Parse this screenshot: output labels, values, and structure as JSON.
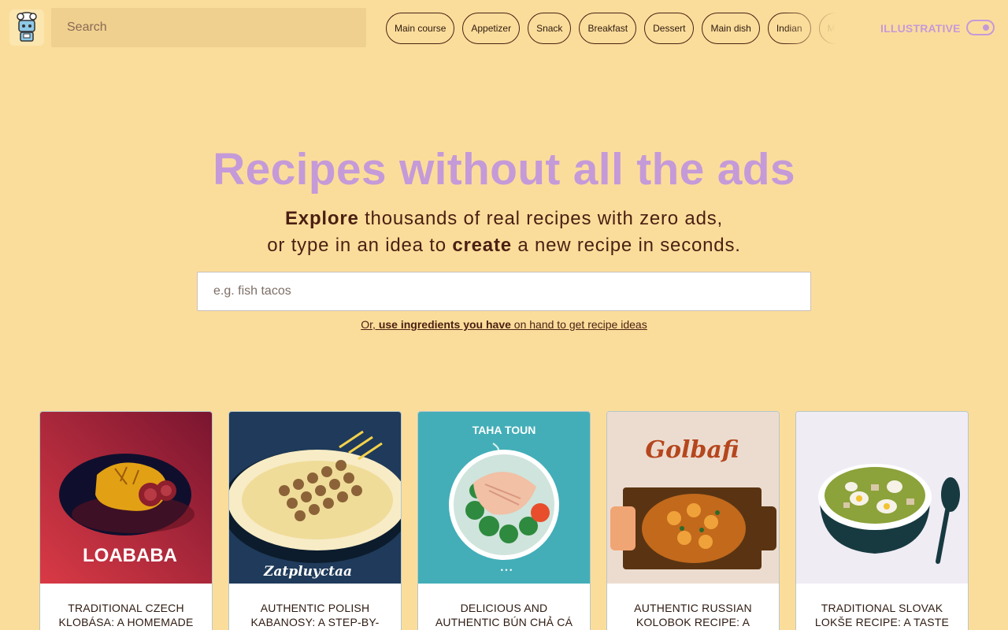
{
  "header": {
    "search_placeholder": "Search",
    "categories": [
      "Main course",
      "Appetizer",
      "Snack",
      "Breakfast",
      "Dessert",
      "Main dish",
      "Indian",
      "Mexican"
    ],
    "mode_label": "ILLUSTRATIVE",
    "mode_toggle_on": true,
    "logo_icon": "chef-robot-icon"
  },
  "hero": {
    "title": "Recipes without all the ads",
    "sub_line1_bold": "Explore",
    "sub_line1_rest": " thousands of real recipes with zero ads,",
    "sub_line2_start": "or type in an idea to ",
    "sub_line2_bold": "create",
    "sub_line2_end": " a new recipe in seconds.",
    "idea_placeholder": "e.g. fish tacos",
    "ingredients_prefix": "Or, ",
    "ingredients_bold": "use ingredients you have",
    "ingredients_suffix": " on hand to get recipe ideas"
  },
  "colors": {
    "background": "#fbdd9b",
    "accent": "#c59ad8",
    "text": "#4a1f12"
  },
  "recipes": [
    {
      "title": "Traditional Czech Klobása: A Homemade",
      "image_text": "LOABABA"
    },
    {
      "title": "Authentic Polish Kabanosy: A Step-By-",
      "image_text": "Zatpluyctaa"
    },
    {
      "title": "Delicious and Authentic Bún Chả Cá",
      "image_text": "TAHA TOUN"
    },
    {
      "title": "Authentic Russian Kolobok Recipe: A",
      "image_text": "Golbafi"
    },
    {
      "title": "Traditional Slovak Lokše Recipe: A Taste",
      "image_text": ""
    }
  ]
}
